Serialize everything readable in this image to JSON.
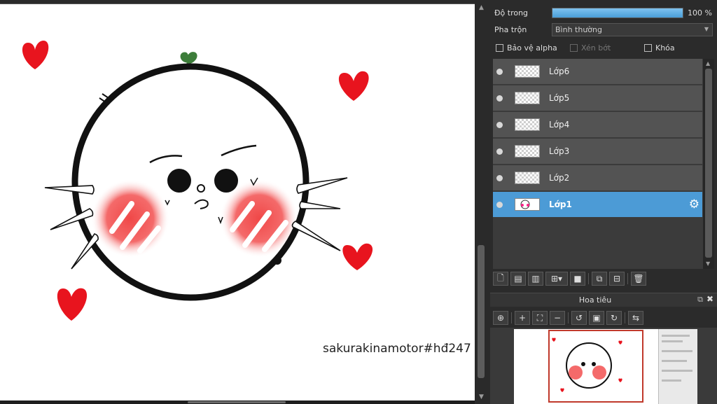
{
  "canvas": {
    "signature": "sakurakinamotor#hđ247",
    "colors": {
      "heart": "#e8141e",
      "outline": "#111111",
      "blush": "#f26a6a",
      "sprout": "#3d7d3a"
    }
  },
  "layer_panel": {
    "opacity_label": "Độ trong",
    "opacity_value": "100 %",
    "opacity_fraction": 1.0,
    "blend_label": "Pha trộn",
    "blend_value": "Bình thường",
    "checkboxes": {
      "alpha_protect": "Bảo vệ alpha",
      "clip": "Xén bớt",
      "lock": "Khóa"
    },
    "layers": [
      {
        "name": "Lớp6",
        "active": false
      },
      {
        "name": "Lớp5",
        "active": false
      },
      {
        "name": "Lớp4",
        "active": false
      },
      {
        "name": "Lớp3",
        "active": false
      },
      {
        "name": "Lớp2",
        "active": false
      },
      {
        "name": "Lớp1",
        "active": true
      }
    ],
    "accent_color": "#4c9bd6"
  },
  "navigator": {
    "title": "Hoa tiêu"
  }
}
